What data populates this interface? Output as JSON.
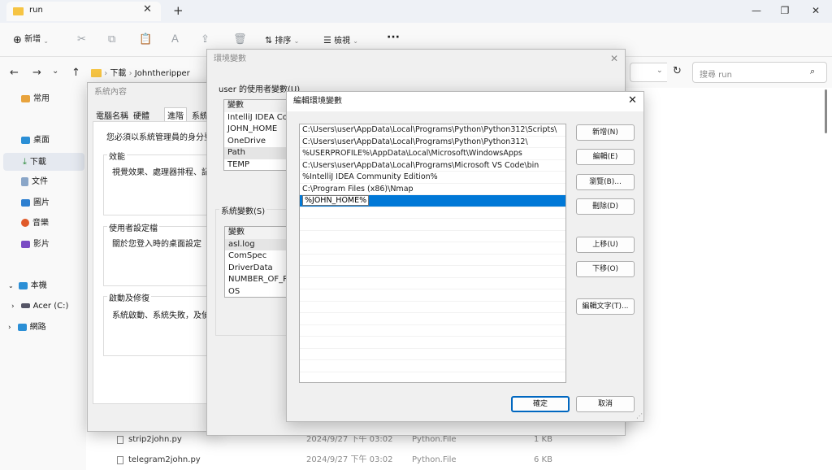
{
  "explorer": {
    "tab_title": "run",
    "new_tab_icon": "plus-icon",
    "window_controls": [
      "minimize-icon",
      "maximize-icon",
      "close-icon"
    ],
    "toolbar": {
      "new_label": "新增",
      "sort_label": "排序",
      "view_label": "檢視"
    },
    "breadcrumb": [
      "下載",
      "Johntheripper"
    ],
    "search_placeholder": "搜尋 run",
    "sidebar": {
      "items": [
        {
          "label": "常用",
          "icon": "home-icon"
        },
        {
          "label": "桌面",
          "icon": "desktop-icon"
        },
        {
          "label": "下載",
          "icon": "download-icon"
        },
        {
          "label": "文件",
          "icon": "document-icon"
        },
        {
          "label": "圖片",
          "icon": "picture-icon"
        },
        {
          "label": "音樂",
          "icon": "music-icon"
        },
        {
          "label": "影片",
          "icon": "video-icon"
        },
        {
          "label": "本機",
          "icon": "pc-icon"
        },
        {
          "label": "Acer (C:)",
          "icon": "drive-icon"
        },
        {
          "label": "網路",
          "icon": "network-icon"
        }
      ]
    },
    "files": [
      {
        "name": "strip2john.py",
        "date": "2024/9/27 下午 03:02",
        "type": "Python.File",
        "size": "1 KB"
      },
      {
        "name": "telegram2john.py",
        "date": "2024/9/27 下午 03:02",
        "type": "Python.File",
        "size": "6 KB"
      }
    ]
  },
  "sysprops": {
    "title": "系統內容",
    "tabs": [
      "電腦名稱",
      "硬體",
      "進階",
      "系統保"
    ],
    "admin_note": "您必須以系統管理員的身分登",
    "perf_group": "效能",
    "perf_text": "視覺效果、處理器排程、記憶",
    "profile_group": "使用者設定檔",
    "profile_text": "關於您登入時的桌面設定",
    "startup_group": "啟動及修復",
    "startup_text": "系統啟動、系統失敗，及偵錯"
  },
  "envvars": {
    "title": "環境變數",
    "user_group": "user 的使用者變數(U)",
    "user_vars": [
      "變數",
      "IntelliJ IDEA Con",
      "JOHN_HOME",
      "OneDrive",
      "Path",
      "TEMP"
    ],
    "sys_group": "系統變數(S)",
    "sys_vars": [
      "變數",
      "asl.log",
      "ComSpec",
      "DriverData",
      "NUMBER_OF_PR",
      "OS"
    ]
  },
  "editenv": {
    "title": "編輯環境變數",
    "paths": [
      "C:\\Users\\user\\AppData\\Local\\Programs\\Python\\Python312\\Scripts\\",
      "C:\\Users\\user\\AppData\\Local\\Programs\\Python\\Python312\\",
      "%USERPROFILE%\\AppData\\Local\\Microsoft\\WindowsApps",
      "C:\\Users\\user\\AppData\\Local\\Programs\\Microsoft VS Code\\bin",
      "%IntelliJ IDEA Community Edition%",
      "C:\\Program Files (x86)\\Nmap"
    ],
    "editing_value": "%JOHN_HOME%",
    "buttons": {
      "new": "新增(N)",
      "edit": "編輯(E)",
      "browse": "瀏覽(B)...",
      "delete": "刪除(D)",
      "up": "上移(U)",
      "down": "下移(O)",
      "edit_text": "編輯文字(T)...",
      "ok": "確定",
      "cancel": "取消"
    }
  }
}
